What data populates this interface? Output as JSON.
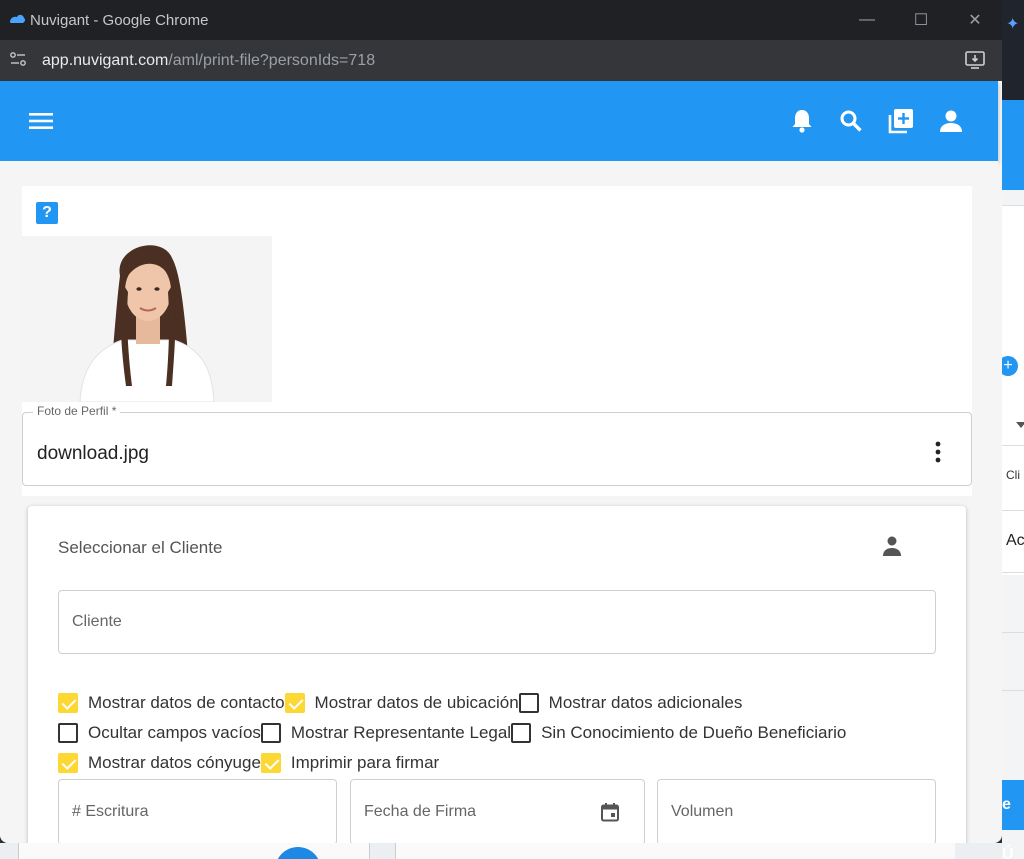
{
  "window": {
    "title": "Nuvigant - Google Chrome",
    "url_host": "app.nuvigant.com",
    "url_path": "/aml/print-file?personIds=718"
  },
  "background_app": {
    "text_1": "Cli",
    "text_2": "Ac",
    "button_label": "e Ú"
  },
  "file": {
    "label": "Foto de Perfil *",
    "value": "download.jpg"
  },
  "client": {
    "heading": "Seleccionar el Cliente",
    "field_placeholder": "Cliente"
  },
  "options": [
    [
      {
        "label": "Mostrar datos de contacto",
        "checked": true
      },
      {
        "label": "Mostrar datos de ubicación",
        "checked": true
      },
      {
        "label": "Mostrar datos adicionales",
        "checked": false
      }
    ],
    [
      {
        "label": "Ocultar campos vacíos",
        "checked": false
      },
      {
        "label": "Mostrar Representante Legal",
        "checked": false
      },
      {
        "label": "Sin Conocimiento de Dueño Beneficiario",
        "checked": false
      }
    ],
    [
      {
        "label": "Mostrar datos cónyuge",
        "checked": true
      },
      {
        "label": "Imprimir para firmar",
        "checked": true
      }
    ]
  ],
  "fields": {
    "escritura": "# Escritura",
    "fecha_firma": "Fecha de Firma",
    "volumen": "Volumen"
  },
  "colors": {
    "primary": "#2196f3",
    "checkbox": "#fdd835"
  }
}
